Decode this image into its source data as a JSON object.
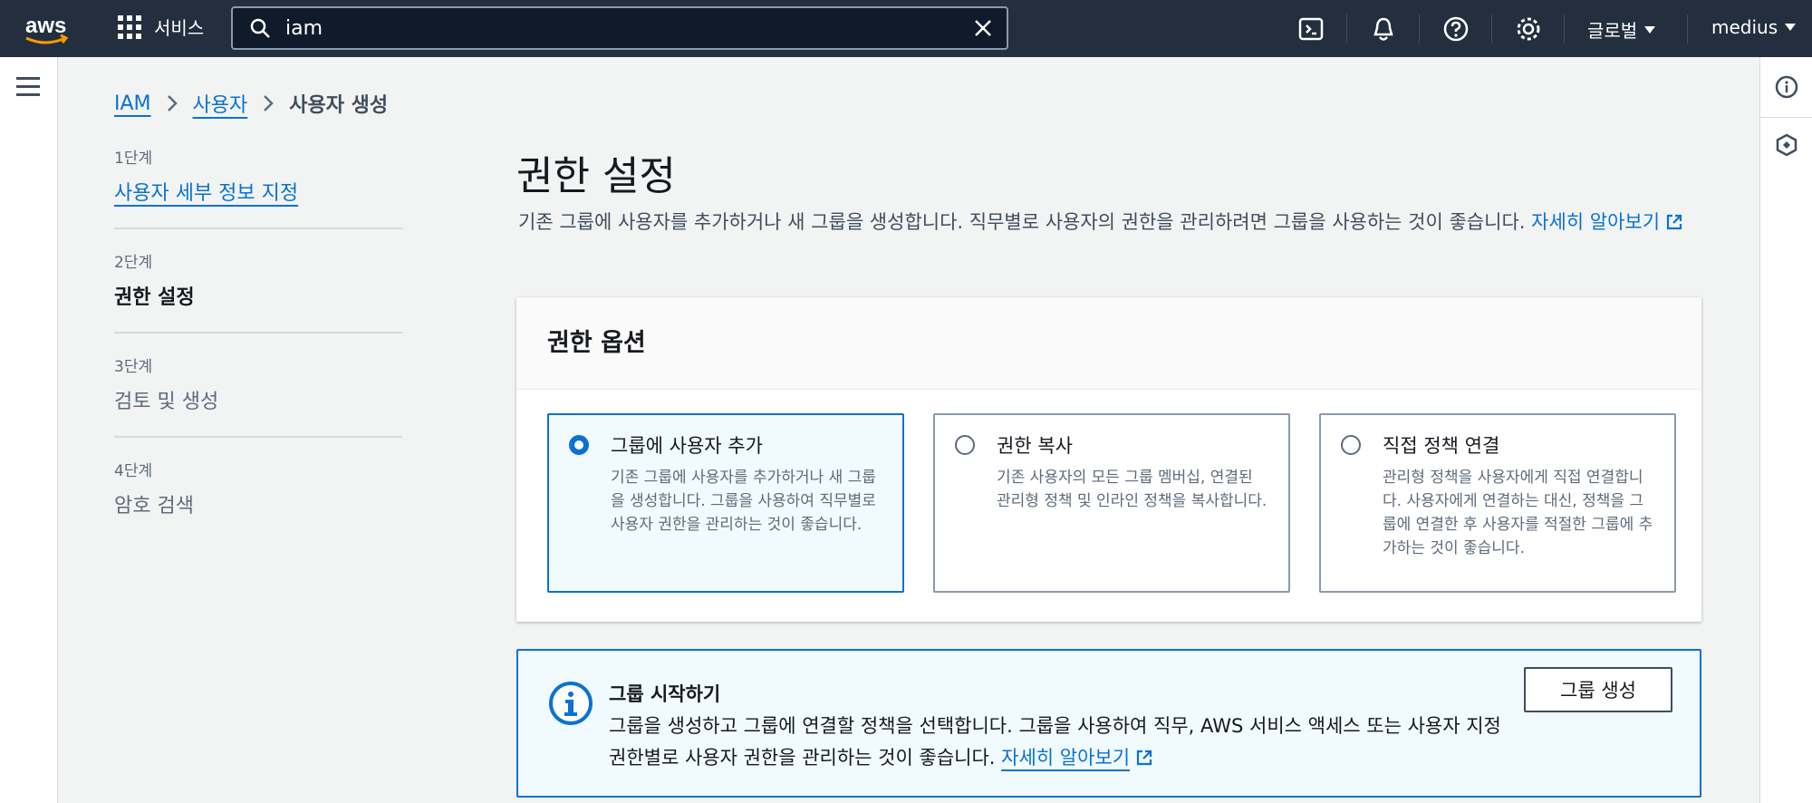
{
  "topnav": {
    "logo_text": "aws",
    "services_label": "서비스",
    "search_value": "iam",
    "region_label": "글로벌",
    "account_label": "medius",
    "icons": [
      "cloudshell-icon",
      "notifications-icon",
      "help-icon",
      "settings-icon"
    ]
  },
  "breadcrumb": {
    "items": [
      "IAM",
      "사용자"
    ],
    "current": "사용자 생성"
  },
  "steps": [
    {
      "num": "1단계",
      "label": "사용자 세부 정보 지정",
      "state": "link"
    },
    {
      "num": "2단계",
      "label": "권한 설정",
      "state": "active"
    },
    {
      "num": "3단계",
      "label": "검토 및 생성",
      "state": "disabled"
    },
    {
      "num": "4단계",
      "label": "암호 검색",
      "state": "disabled"
    }
  ],
  "main": {
    "title": "권한 설정",
    "description": "기존 그룹에 사용자를 추가하거나 새 그룹을 생성합니다. 직무별로 사용자의 권한을 관리하려면 그룹을 사용하는 것이 좋습니다. ",
    "learn_more": "자세히 알아보기"
  },
  "permission_options": {
    "heading": "권한 옵션",
    "tiles": [
      {
        "title": "그룹에 사용자 추가",
        "desc": "기존 그룹에 사용자를 추가하거나 새 그룹을 생성합니다. 그룹을 사용하여 직무별로 사용자 권한을 관리하는 것이 좋습니다.",
        "selected": true
      },
      {
        "title": "권한 복사",
        "desc": "기존 사용자의 모든 그룹 멤버십, 연결된 관리형 정책 및 인라인 정책을 복사합니다.",
        "selected": false
      },
      {
        "title": "직접 정책 연결",
        "desc": "관리형 정책을 사용자에게 직접 연결합니다. 사용자에게 연결하는 대신, 정책을 그룹에 연결한 후 사용자를 적절한 그룹에 추가하는 것이 좋습니다.",
        "selected": false
      }
    ]
  },
  "info_box": {
    "title": "그룹 시작하기",
    "body": "그룹을 생성하고 그룹에 연결할 정책을 선택합니다. 그룹을 사용하여 직무, AWS 서비스 액세스 또는 사용자 지정 권한별로 사용자 권한을 관리하는 것이 좋습니다. ",
    "learn_more": "자세히 알아보기",
    "button_label": "그룹 생성"
  },
  "colors": {
    "nav_bg": "#232f3e",
    "link": "#0972d3",
    "accent_bg": "#f1faff",
    "logo_orange": "#ff9900"
  }
}
